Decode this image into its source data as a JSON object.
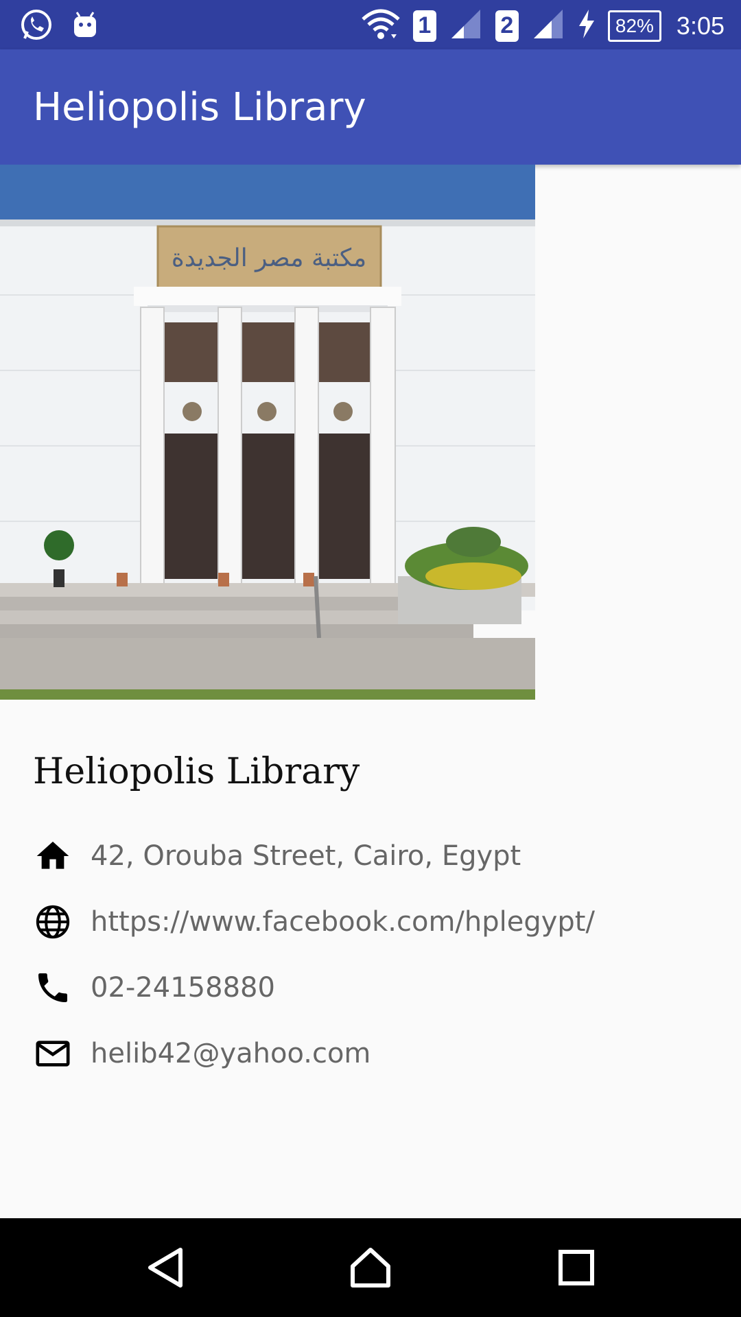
{
  "status_bar": {
    "sim1_label": "1",
    "sim2_label": "2",
    "battery_text": "82%",
    "time": "3:05",
    "icons": [
      "whatsapp-icon",
      "android-icon",
      "wifi-icon",
      "signal-icon",
      "signal-icon",
      "charging-icon"
    ]
  },
  "app_bar": {
    "title": "Heliopolis Library",
    "color": "#3f51b5",
    "status_color": "#303f9f"
  },
  "photo": {
    "sign_text": "مكتبة مصر الجديدة"
  },
  "place": {
    "name": "Heliopolis Library",
    "address": "42, Orouba Street, Cairo, Egypt",
    "website": "https://www.facebook.com/hplegypt/",
    "phone": "02-24158880",
    "email": "helib42@yahoo.com"
  },
  "nav_bar": {
    "icons": [
      "back-icon",
      "home-icon",
      "recents-icon"
    ]
  }
}
